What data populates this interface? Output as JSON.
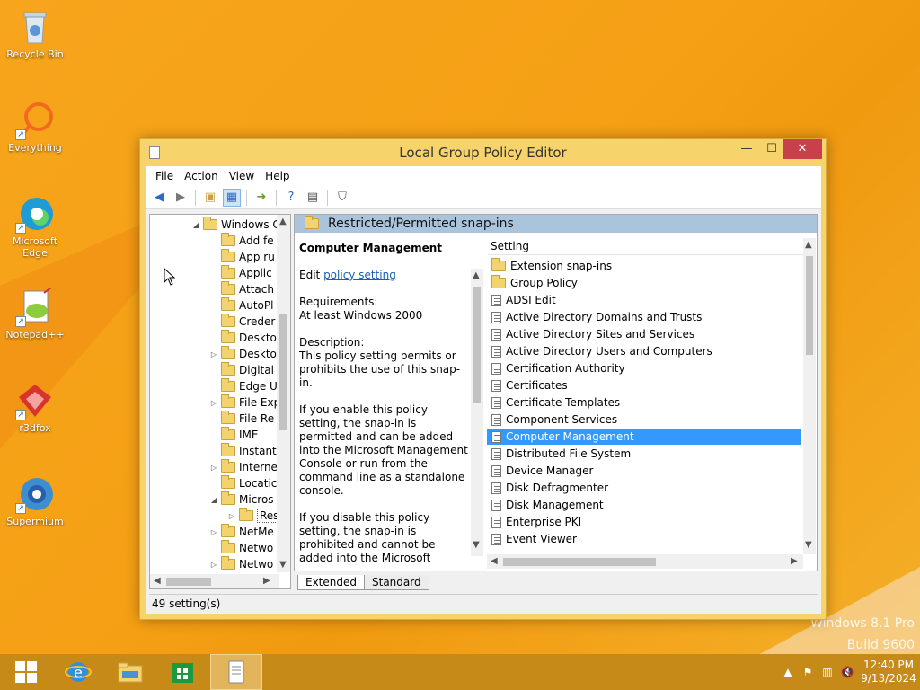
{
  "desktop": {
    "icons": [
      {
        "label": "Recycle Bin"
      },
      {
        "label": "Everything"
      },
      {
        "label": "Microsoft Edge"
      },
      {
        "label": "Notepad++"
      },
      {
        "label": "r3dfox"
      },
      {
        "label": "Supermium"
      }
    ],
    "watermark_line1": "Windows 8.1 Pro",
    "watermark_line2": "Build 9600"
  },
  "window": {
    "title": "Local Group Policy Editor",
    "buttons": {
      "minimize": "—",
      "maximize": "☐",
      "close": "✕"
    }
  },
  "menu": [
    "File",
    "Action",
    "View",
    "Help"
  ],
  "tree": {
    "items": [
      {
        "label": "Windows C",
        "expander": "◢"
      },
      {
        "label": "Add fe",
        "expander": ""
      },
      {
        "label": "App ru",
        "expander": ""
      },
      {
        "label": "Applic",
        "expander": ""
      },
      {
        "label": "Attach",
        "expander": ""
      },
      {
        "label": "AutoPl",
        "expander": ""
      },
      {
        "label": "Creder",
        "expander": ""
      },
      {
        "label": "Deskto",
        "expander": ""
      },
      {
        "label": "Deskto",
        "expander": "▷"
      },
      {
        "label": "Digital",
        "expander": ""
      },
      {
        "label": "Edge U",
        "expander": ""
      },
      {
        "label": "File Exp",
        "expander": "▷"
      },
      {
        "label": "File Re",
        "expander": ""
      },
      {
        "label": "IME",
        "expander": ""
      },
      {
        "label": "Instant",
        "expander": ""
      },
      {
        "label": "Interne",
        "expander": "▷"
      },
      {
        "label": "Locatic",
        "expander": ""
      },
      {
        "label": "Micros",
        "expander": "◢"
      },
      {
        "label": "Res",
        "expander": "▷"
      },
      {
        "label": "NetMe",
        "expander": "▷"
      },
      {
        "label": "Netwo",
        "expander": ""
      },
      {
        "label": "Netwo",
        "expander": "▷"
      }
    ]
  },
  "content": {
    "header_title": "Restricted/Permitted snap-ins",
    "description": {
      "title": "Computer Management",
      "edit_prefix": "Edit ",
      "edit_link": "policy setting ",
      "requirements_label": "Requirements:",
      "requirements_value": "At least Windows 2000",
      "description_label": "Description:",
      "description_text": "This policy setting permits or prohibits the use of this snap-in.",
      "enable_text": "If you enable this policy setting, the snap-in is permitted and can be added into the Microsoft Management Console or run from the command line as a standalone console.",
      "disable_text": "If you disable this policy setting, the snap-in is prohibited and cannot be added into the Microsoft Management Console or run from the command line as a standalone console. An error"
    },
    "list_header": "Setting",
    "list_items": [
      {
        "label": "Extension snap-ins",
        "type": "folder"
      },
      {
        "label": "Group Policy",
        "type": "folder"
      },
      {
        "label": "ADSI Edit",
        "type": "setting"
      },
      {
        "label": "Active Directory Domains and Trusts",
        "type": "setting"
      },
      {
        "label": "Active Directory Sites and Services",
        "type": "setting"
      },
      {
        "label": "Active Directory Users and Computers",
        "type": "setting"
      },
      {
        "label": "Certification Authority",
        "type": "setting"
      },
      {
        "label": "Certificates",
        "type": "setting"
      },
      {
        "label": "Certificate Templates",
        "type": "setting"
      },
      {
        "label": "Component Services",
        "type": "setting"
      },
      {
        "label": "Computer Management",
        "type": "setting",
        "selected": true
      },
      {
        "label": "Distributed File System",
        "type": "setting"
      },
      {
        "label": "Device Manager",
        "type": "setting"
      },
      {
        "label": "Disk Defragmenter",
        "type": "setting"
      },
      {
        "label": "Disk Management",
        "type": "setting"
      },
      {
        "label": "Enterprise PKI",
        "type": "setting"
      },
      {
        "label": "Event Viewer",
        "type": "setting"
      }
    ],
    "tabs": [
      "Extended",
      "Standard"
    ]
  },
  "status": "49 setting(s)",
  "taskbar": {
    "time": "12:40 PM",
    "date": "9/13/2024"
  },
  "colors": {
    "selection": "#3399ff",
    "window_frame": "#f6d36b",
    "close_button": "#c7404b",
    "header_band": "#aac4dc"
  }
}
